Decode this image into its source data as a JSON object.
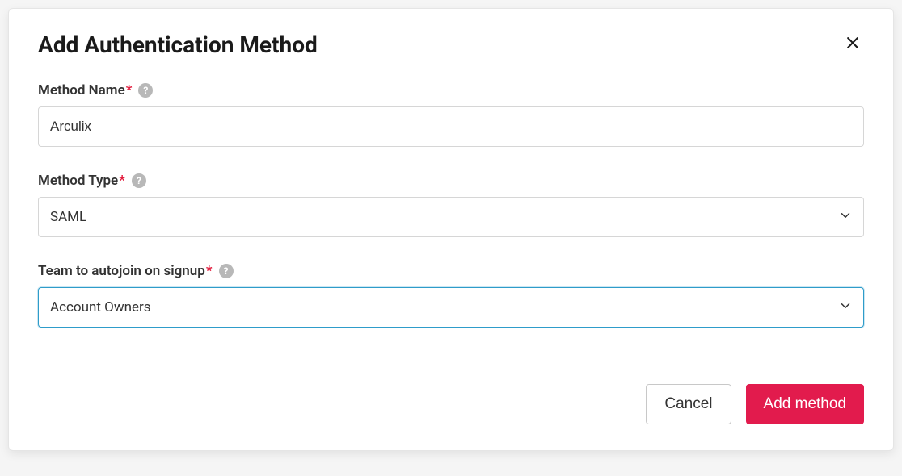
{
  "modal": {
    "title": "Add Authentication Method",
    "fields": {
      "methodName": {
        "label": "Method Name",
        "value": "Arculix"
      },
      "methodType": {
        "label": "Method Type",
        "value": "SAML"
      },
      "teamAutojoin": {
        "label": "Team to autojoin on signup",
        "value": "Account Owners"
      }
    },
    "buttons": {
      "cancel": "Cancel",
      "submit": "Add method"
    },
    "required_marker": "*",
    "help_marker": "?"
  }
}
